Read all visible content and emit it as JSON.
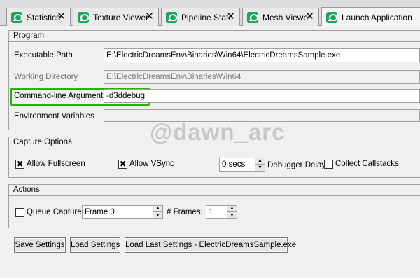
{
  "tabs": [
    {
      "label": "Statistics",
      "active": false
    },
    {
      "label": "Texture Viewer",
      "active": false
    },
    {
      "label": "Pipeline State",
      "active": false
    },
    {
      "label": "Mesh Viewer",
      "active": false
    },
    {
      "label": "Launch Application",
      "active": true
    }
  ],
  "program": {
    "title": "Program",
    "exe_label": "Executable Path",
    "exe_value": "E:\\ElectricDreamsEnv\\Binaries\\Win64\\ElectricDreamsSample.exe",
    "workdir_label": "Working Directory",
    "workdir_placeholder": "E:\\ElectricDreamsEnv\\Binaries\\Win64",
    "args_label": "Command-line Arguments",
    "args_value": "-d3ddebug",
    "env_label": "Environment Variables",
    "env_value": ""
  },
  "capture": {
    "title": "Capture Options",
    "allow_fullscreen": "Allow Fullscreen",
    "allow_fullscreen_checked": true,
    "allow_vsync": "Allow VSync",
    "allow_vsync_checked": true,
    "delay_value": "0 secs",
    "delay_label": "Debugger Delay",
    "collect_callstacks": "Collect Callstacks",
    "collect_callstacks_checked": false
  },
  "actions": {
    "title": "Actions",
    "queue_capture": "Queue Capture",
    "queue_capture_checked": false,
    "frame_value": "Frame 0",
    "frames_label": "# Frames:",
    "frames_value": "1"
  },
  "buttons": {
    "save": "Save Settings",
    "load": "Load Settings",
    "load_last": "Load Last Settings - ElectricDreamsSample.exe"
  },
  "watermark": "@dawn_arc",
  "colors": {
    "highlight": "#27b400",
    "tab_icon": "#20a35c"
  }
}
